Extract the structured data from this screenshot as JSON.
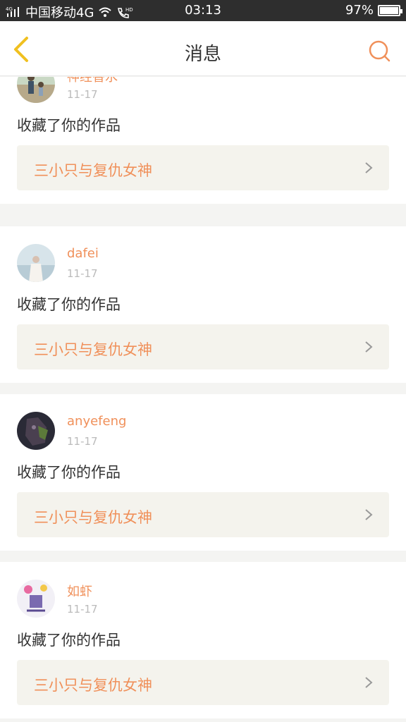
{
  "status_bar": {
    "carrier": "中国移动4G",
    "net_tag": "4G",
    "hd_tag": "HD",
    "time": "03:13",
    "battery": "97%"
  },
  "nav": {
    "title": "消息",
    "back_icon": "chevron-left-icon",
    "search_icon": "search-icon",
    "accent_color": "#f0905a",
    "back_color": "#f0c020"
  },
  "messages": [
    {
      "username": "神经香水",
      "date": "11-17",
      "action": "收藏了你的作品",
      "work_title": "三小只与复仇女神"
    },
    {
      "username": "dafei",
      "date": "11-17",
      "action": "收藏了你的作品",
      "work_title": "三小只与复仇女神"
    },
    {
      "username": "anyefeng",
      "date": "11-17",
      "action": "收藏了你的作品",
      "work_title": "三小只与复仇女神"
    },
    {
      "username": "如虾",
      "date": "11-17",
      "action": "收藏了你的作品",
      "work_title": "三小只与复仇女神"
    }
  ]
}
